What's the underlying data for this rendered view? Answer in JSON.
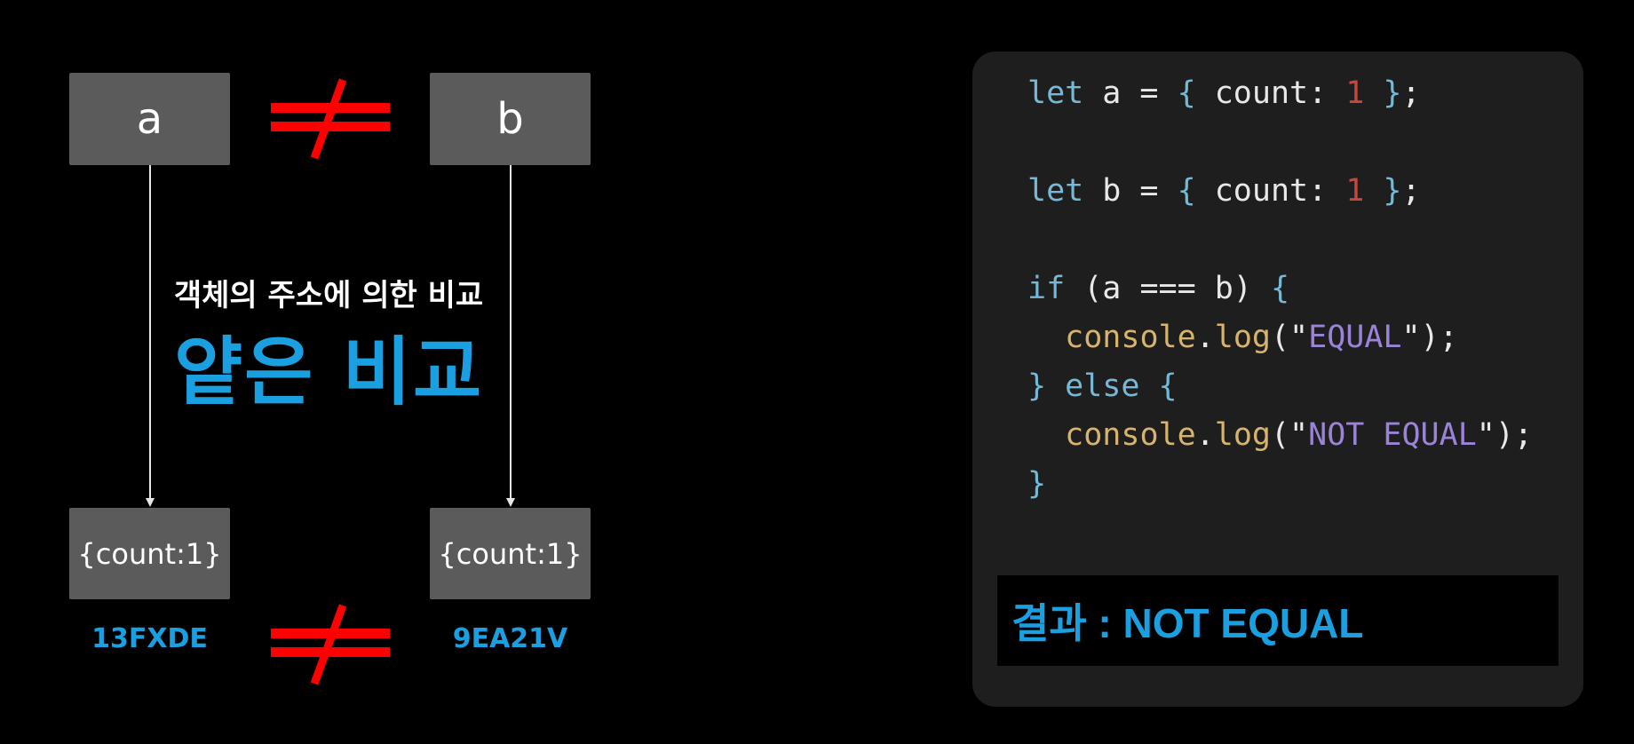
{
  "diagram": {
    "var_a": "a",
    "var_b": "b",
    "obj_a": "{count:1}",
    "obj_b": "{count:1}",
    "addr_a": "13FXDE",
    "addr_b": "9EA21V",
    "caption_small": "객체의 주소에 의한 비교",
    "caption_big": "얕은 비교"
  },
  "code": {
    "lines": [
      [
        "let",
        " a = ",
        "{",
        " count: ",
        "1",
        " ",
        "}",
        ";"
      ],
      [
        "let",
        " b = ",
        "{",
        " count: ",
        "1",
        " ",
        "}",
        ";"
      ],
      [
        "if",
        " (a === b) ",
        "{"
      ],
      [
        "console",
        ".",
        "log",
        "(",
        "\"",
        "EQUAL",
        "\"",
        ");"
      ],
      [
        "}",
        " else ",
        "{"
      ],
      [
        "console",
        ".",
        "log",
        "(",
        "\"",
        "NOT EQUAL",
        "\"",
        ");"
      ],
      [
        "}"
      ]
    ]
  },
  "result": {
    "label": "결과 : NOT EQUAL"
  },
  "colors": {
    "accent": "#1aa0e0",
    "neq": "#ff0000",
    "box": "#5b5b5b",
    "code_bg": "#1e1e1e"
  }
}
